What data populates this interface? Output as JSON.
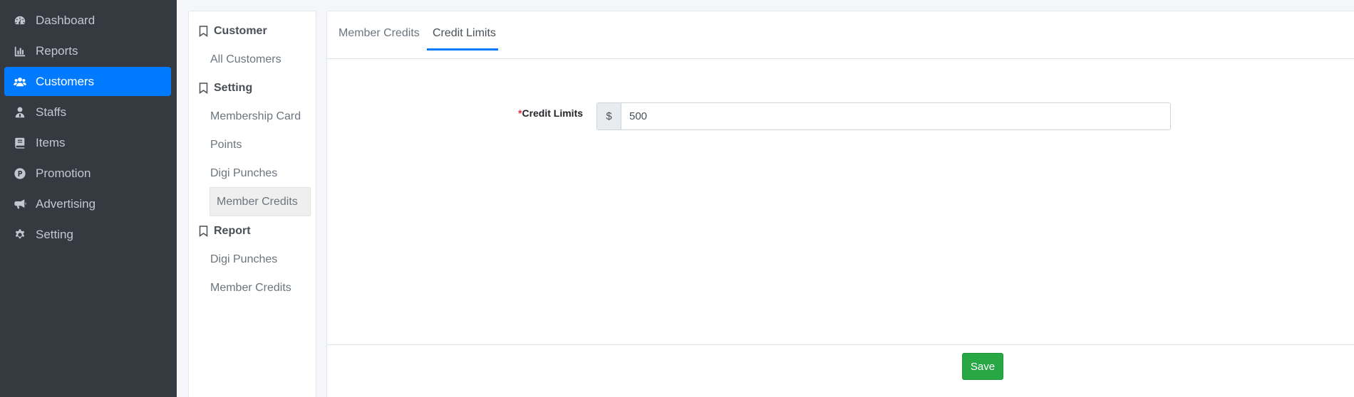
{
  "sidebar": {
    "items": [
      {
        "label": "Dashboard",
        "icon": "dashboard-icon"
      },
      {
        "label": "Reports",
        "icon": "chart-bar-icon"
      },
      {
        "label": "Customers",
        "icon": "users-icon",
        "active": true
      },
      {
        "label": "Staffs",
        "icon": "user-tie-icon"
      },
      {
        "label": "Items",
        "icon": "book-icon"
      },
      {
        "label": "Promotion",
        "icon": "product-hunt-icon"
      },
      {
        "label": "Advertising",
        "icon": "bullhorn-icon"
      },
      {
        "label": "Setting",
        "icon": "gear-icon"
      }
    ]
  },
  "subnav": {
    "sections": [
      {
        "title": "Customer",
        "items": [
          "All Customers"
        ]
      },
      {
        "title": "Setting",
        "items": [
          "Membership Card",
          "Points",
          "Digi Punches",
          "Member Credits"
        ]
      },
      {
        "title": "Report",
        "items": [
          "Digi Punches",
          "Member Credits"
        ]
      }
    ],
    "active_item": "Member Credits"
  },
  "tabs": [
    {
      "label": "Member Credits"
    },
    {
      "label": "Credit Limits",
      "active": true
    }
  ],
  "form": {
    "required_mark": "*",
    "label": "Credit Limits",
    "prefix": "$",
    "value": "500"
  },
  "save_label": "Save",
  "colors": {
    "sidebar_bg": "#343a40",
    "accent": "#007bff",
    "save": "#28a745",
    "required": "#dc3545"
  }
}
